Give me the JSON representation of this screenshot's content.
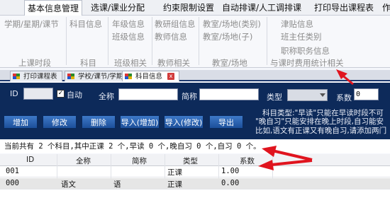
{
  "menu": {
    "tabs": [
      "基本信息管理",
      "选课/课业分配",
      "约束限制设置",
      "自动排课/人工调排课",
      "打印导出课程表",
      "作"
    ]
  },
  "ribbon": {
    "col1": {
      "items": [
        "学期/星期/课节"
      ],
      "group": "上课时段"
    },
    "col2": {
      "items": [
        "科目信息"
      ],
      "group": "科目"
    },
    "col3": {
      "items": [
        "年级信息",
        "班级信息"
      ],
      "group": "班级相关"
    },
    "col4": {
      "items": [
        "教研组信息",
        "教师信息"
      ],
      "group": "教师相关"
    },
    "col5": {
      "items": [
        "教室/场地(类别)",
        "教室/场地(子)"
      ],
      "group": "教室/场地"
    },
    "col6": {
      "items": [
        "津贴信息",
        "班主任类别",
        "职称职务信息"
      ],
      "group": "与课时费用统计相关"
    }
  },
  "doc_tabs": [
    {
      "label": "打印课程表"
    },
    {
      "label": "学校/课节/学期"
    },
    {
      "label": "科目信息",
      "close": "x"
    }
  ],
  "form": {
    "id_label": "ID",
    "id_value": "",
    "auto_label": "自动",
    "auto_checked": "✓",
    "fullname_label": "全称",
    "fullname_value": "",
    "shortname_label": "简称",
    "shortname_value": "",
    "type_label": "类型",
    "type_value": "",
    "coef_label": "系数",
    "coef_value": "0"
  },
  "toolbar": {
    "buttons": [
      "增加",
      "修改",
      "删除",
      "导入(增加)",
      "导入(修改)",
      "导出"
    ]
  },
  "note": {
    "line1": "科目类型:\"早读\"只能在早读时段不可",
    "line2": "\"晚自习\"只能安排在晚上时段,自习能安",
    "line3": "比如,语文有正课又有晚自习,请添加两门"
  },
  "status": "当前共有 2 个科目,其中正课 2 个,早读 0 个,晚自习 0 个,自习 0 个。",
  "grid": {
    "headers": [
      "ID",
      "全称",
      "简称",
      "类型",
      "系数"
    ],
    "rows": [
      [
        "001",
        "",
        "",
        "正课",
        "1.00"
      ],
      [
        "000",
        "语文",
        "语",
        "正课",
        "0.00"
      ]
    ]
  },
  "colors": {
    "panel_bg": "#0d2a5a",
    "button_bg": "#2a63b4",
    "annotation_red": "#e0141e"
  }
}
